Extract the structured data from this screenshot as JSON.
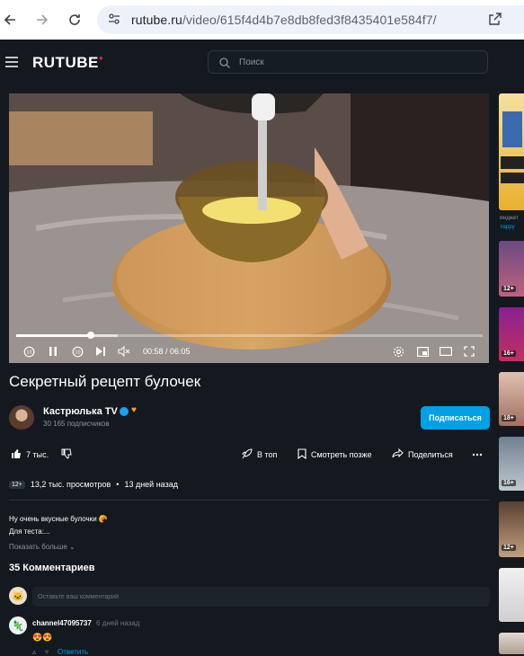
{
  "browser": {
    "url_host": "rutube.ru",
    "url_path": "/video/615f4d4b7e8db8fed3f8435401e584f7/"
  },
  "header": {
    "logo": "RUTUBE",
    "search_placeholder": "Поиск"
  },
  "player": {
    "time": "00:58 / 06:05",
    "progress": 0.16
  },
  "video": {
    "title": "Секретный рецепт булочек",
    "channel_name": "Кастрюлька TV",
    "subscribers": "30 165 подписчиков",
    "subscribe_label": "Подписаться",
    "likes": "7 тыс.",
    "to_top_label": "В топ",
    "watch_later_label": "Смотреть позже",
    "share_label": "Поделиться",
    "age_rating": "12+",
    "views": "13,2 тыс. просмотров",
    "dot": "•",
    "posted": "13 дней назад",
    "description_line1": "Ну очень вкусные булочки 🥐",
    "description_line2": "Для теста:...",
    "show_more_label": "Показать больше"
  },
  "comments": {
    "count_title": "35 Комментариев",
    "input_placeholder": "Оставьте ваш комментарий",
    "items": [
      {
        "author": "channel47095737",
        "time": "6 дней назад",
        "text": "😍😍",
        "reply_label": "Ответить"
      }
    ]
  },
  "sidebar": {
    "items": [
      {
        "label": "Виджет",
        "sublabel": "Yappy",
        "badge": ""
      },
      {
        "badge": "12+"
      },
      {
        "badge": "16+"
      },
      {
        "badge": "18+"
      },
      {
        "badge": "16+"
      },
      {
        "badge": "12+"
      }
    ]
  },
  "colors": {
    "background": "#14191f",
    "accent": "#00a1e7",
    "brand_red": "#ee1c3d"
  }
}
